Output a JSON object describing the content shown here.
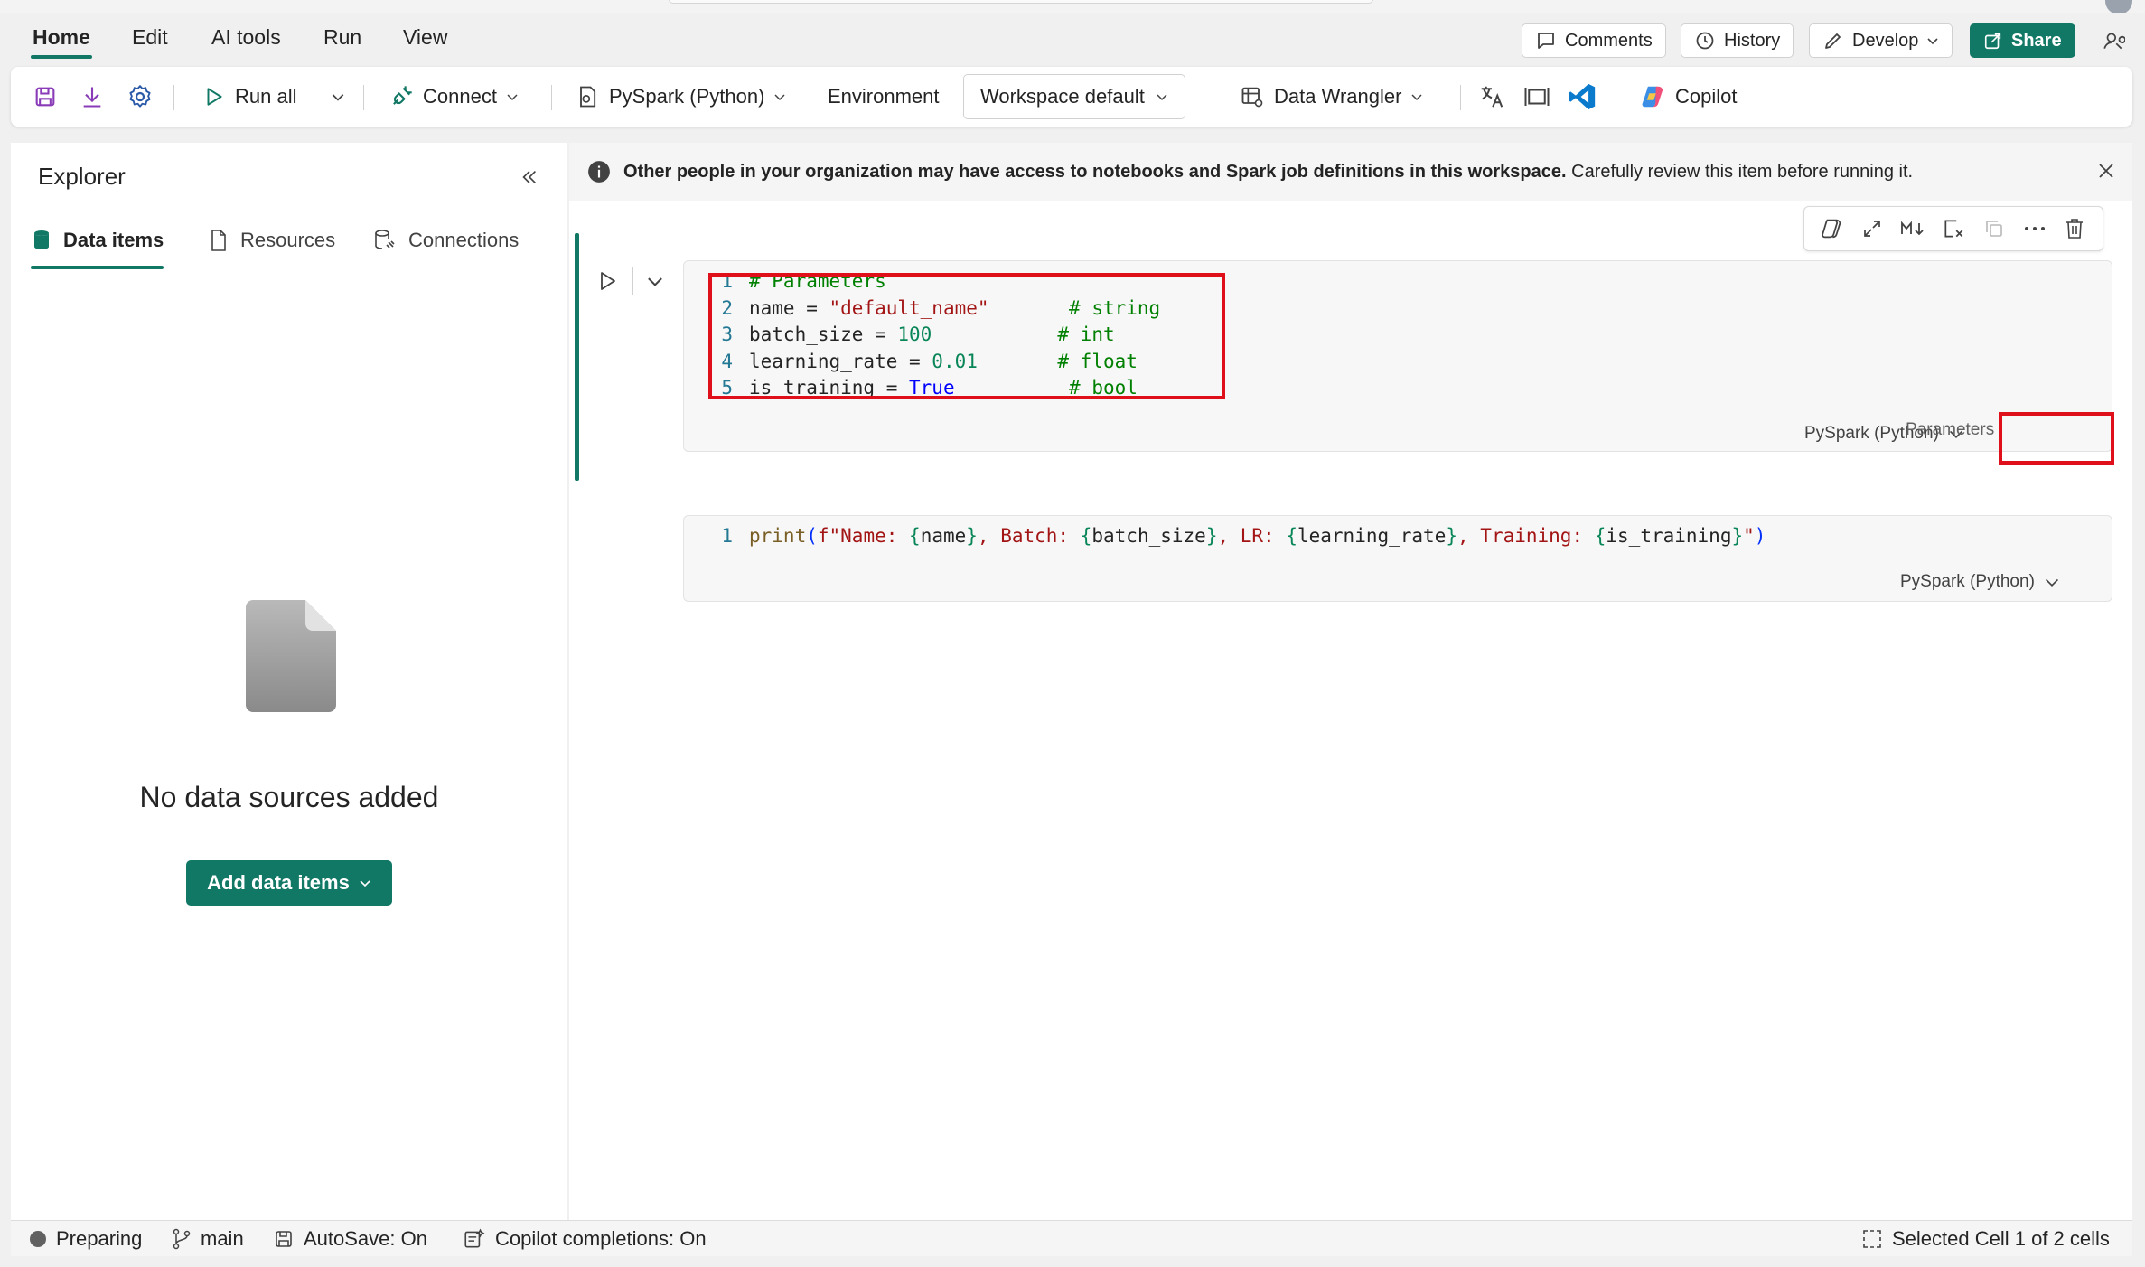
{
  "menu": {
    "tabs": [
      "Home",
      "Edit",
      "AI tools",
      "Run",
      "View"
    ],
    "comments": "Comments",
    "history": "History",
    "develop": "Develop",
    "share": "Share"
  },
  "toolbar": {
    "run_all": "Run all",
    "connect": "Connect",
    "language": "PySpark (Python)",
    "environment_label": "Environment",
    "environment_value": "Workspace default",
    "data_wrangler": "Data Wrangler",
    "copilot": "Copilot"
  },
  "explorer": {
    "title": "Explorer",
    "tabs": [
      "Data items",
      "Resources",
      "Connections"
    ],
    "empty_title": "No data sources added",
    "add_button": "Add data items"
  },
  "banner": {
    "bold": "Other people in your organization may have access to notebooks and Spark job definitions in this workspace.",
    "rest": "Carefully review this item before running it."
  },
  "cells": [
    {
      "lines": [
        [
          {
            "t": "# Parameters",
            "c": "cm"
          }
        ],
        [
          {
            "t": "name = ",
            "c": ""
          },
          {
            "t": "\"default_name\"",
            "c": "st"
          },
          {
            "t": "       ",
            "c": ""
          },
          {
            "t": "# string",
            "c": "cm"
          }
        ],
        [
          {
            "t": "batch_size = ",
            "c": ""
          },
          {
            "t": "100",
            "c": "nm"
          },
          {
            "t": "           ",
            "c": ""
          },
          {
            "t": "# int",
            "c": "cm"
          }
        ],
        [
          {
            "t": "learning_rate = ",
            "c": ""
          },
          {
            "t": "0.01",
            "c": "nm"
          },
          {
            "t": "       ",
            "c": ""
          },
          {
            "t": "# float",
            "c": "cm"
          }
        ],
        [
          {
            "t": "is_training = ",
            "c": ""
          },
          {
            "t": "True",
            "c": "kw"
          },
          {
            "t": "          ",
            "c": ""
          },
          {
            "t": "# bool",
            "c": "cm"
          }
        ]
      ],
      "language": "PySpark (Python)",
      "tag": "Parameters"
    },
    {
      "lines": [
        [
          {
            "t": "print",
            "c": "br"
          },
          {
            "t": "(",
            "c": "br2"
          },
          {
            "t": "f\"Name: ",
            "c": "st"
          },
          {
            "t": "{",
            "c": "nm"
          },
          {
            "t": "name",
            "c": ""
          },
          {
            "t": "}",
            "c": "nm"
          },
          {
            "t": ", Batch: ",
            "c": "st"
          },
          {
            "t": "{",
            "c": "nm"
          },
          {
            "t": "batch_size",
            "c": ""
          },
          {
            "t": "}",
            "c": "nm"
          },
          {
            "t": ", LR: ",
            "c": "st"
          },
          {
            "t": "{",
            "c": "nm"
          },
          {
            "t": "learning_rate",
            "c": ""
          },
          {
            "t": "}",
            "c": "nm"
          },
          {
            "t": ", Training: ",
            "c": "st"
          },
          {
            "t": "{",
            "c": "nm"
          },
          {
            "t": "is_training",
            "c": ""
          },
          {
            "t": "}",
            "c": "nm"
          },
          {
            "t": "\"",
            "c": "st"
          },
          {
            "t": ")",
            "c": "br2"
          }
        ]
      ],
      "language": "PySpark (Python)"
    }
  ],
  "status": {
    "state": "Preparing",
    "branch": "main",
    "autosave": "AutoSave: On",
    "copilot": "Copilot completions: On",
    "selection": "Selected Cell 1 of 2 cells"
  },
  "colors": {
    "accent": "#117865",
    "highlight": "#e0101a"
  }
}
